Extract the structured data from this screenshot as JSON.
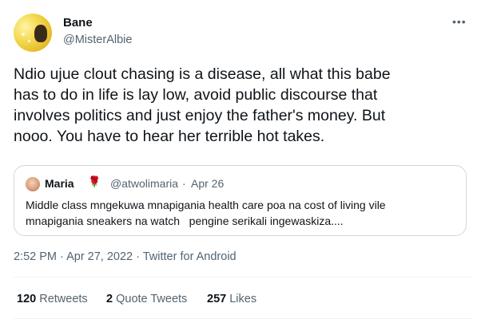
{
  "author": {
    "name": "Bane",
    "handle": "@MisterAlbie"
  },
  "more_icon": "more-icon",
  "tweet_text": "Ndio ujue clout chasing is a disease, all what this babe\nhas to do in life is lay low, avoid public discourse that\ninvolves politics and just enjoy the father's money. But\nnooo. You have to hear her terrible hot takes.",
  "quote": {
    "name": "Maria",
    "emoji": "🌹",
    "handle": "@atwolimaria",
    "separator": "·",
    "date": "Apr 26",
    "text": "Middle class mngekuwa mnapigania health care poa na cost of living vile\nmnapigania sneakers na watch   pengine serikali ingewaskiza...."
  },
  "meta": "2:52 PM · Apr 27, 2022 · Twitter for Android",
  "stats": {
    "retweets_count": "120",
    "retweets_label": "Retweets",
    "quotes_count": "2",
    "quotes_label": "Quote Tweets",
    "likes_count": "257",
    "likes_label": "Likes"
  },
  "colors": {
    "text": "#0f1419",
    "secondary": "#536471",
    "border": "#cfd9de",
    "divider": "#eff3f4"
  }
}
